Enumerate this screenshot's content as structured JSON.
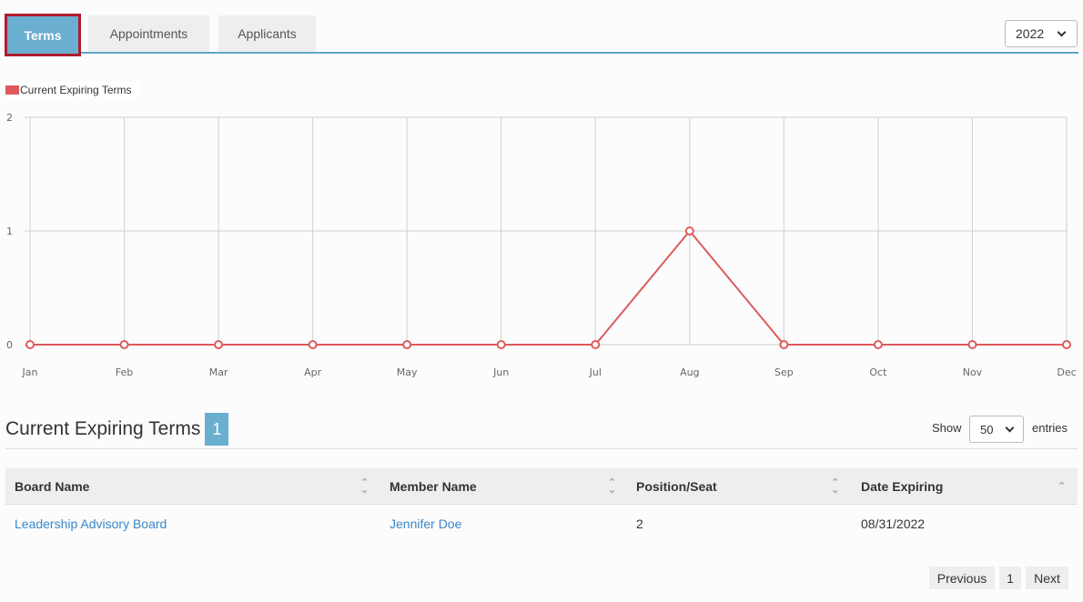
{
  "tabs": [
    {
      "label": "Terms",
      "active": true
    },
    {
      "label": "Appointments",
      "active": false
    },
    {
      "label": "Applicants",
      "active": false
    }
  ],
  "year_select": {
    "value": "2022"
  },
  "chart_data": {
    "type": "line",
    "title": "",
    "xlabel": "",
    "ylabel": "",
    "categories": [
      "Jan",
      "Feb",
      "Mar",
      "Apr",
      "May",
      "Jun",
      "Jul",
      "Aug",
      "Sep",
      "Oct",
      "Nov",
      "Dec"
    ],
    "series": [
      {
        "name": "Current Expiring Terms",
        "values": [
          0,
          0,
          0,
          0,
          0,
          0,
          0,
          1,
          0,
          0,
          0,
          0
        ],
        "color": "#dd5b5b"
      }
    ],
    "ylim": [
      0,
      2
    ],
    "yticks": [
      "0",
      "1",
      "2"
    ],
    "grid": true,
    "legend": "top-left"
  },
  "section": {
    "title": "Current Expiring Terms",
    "count": "1",
    "show_label": "Show",
    "entries_value": "50",
    "entries_label": "entries"
  },
  "table": {
    "columns": [
      "Board Name",
      "Member Name",
      "Position/Seat",
      "Date Expiring"
    ],
    "rows": [
      [
        "Leadership Advisory Board",
        "Jennifer Doe",
        "2",
        "08/31/2022"
      ]
    ]
  },
  "pagination": {
    "previous": "Previous",
    "page": "1",
    "next": "Next"
  },
  "colors": {
    "accent": "#6aaed0",
    "active_border": "#b01c2e",
    "series": "#dd5b5b",
    "link": "#3a86c8"
  }
}
